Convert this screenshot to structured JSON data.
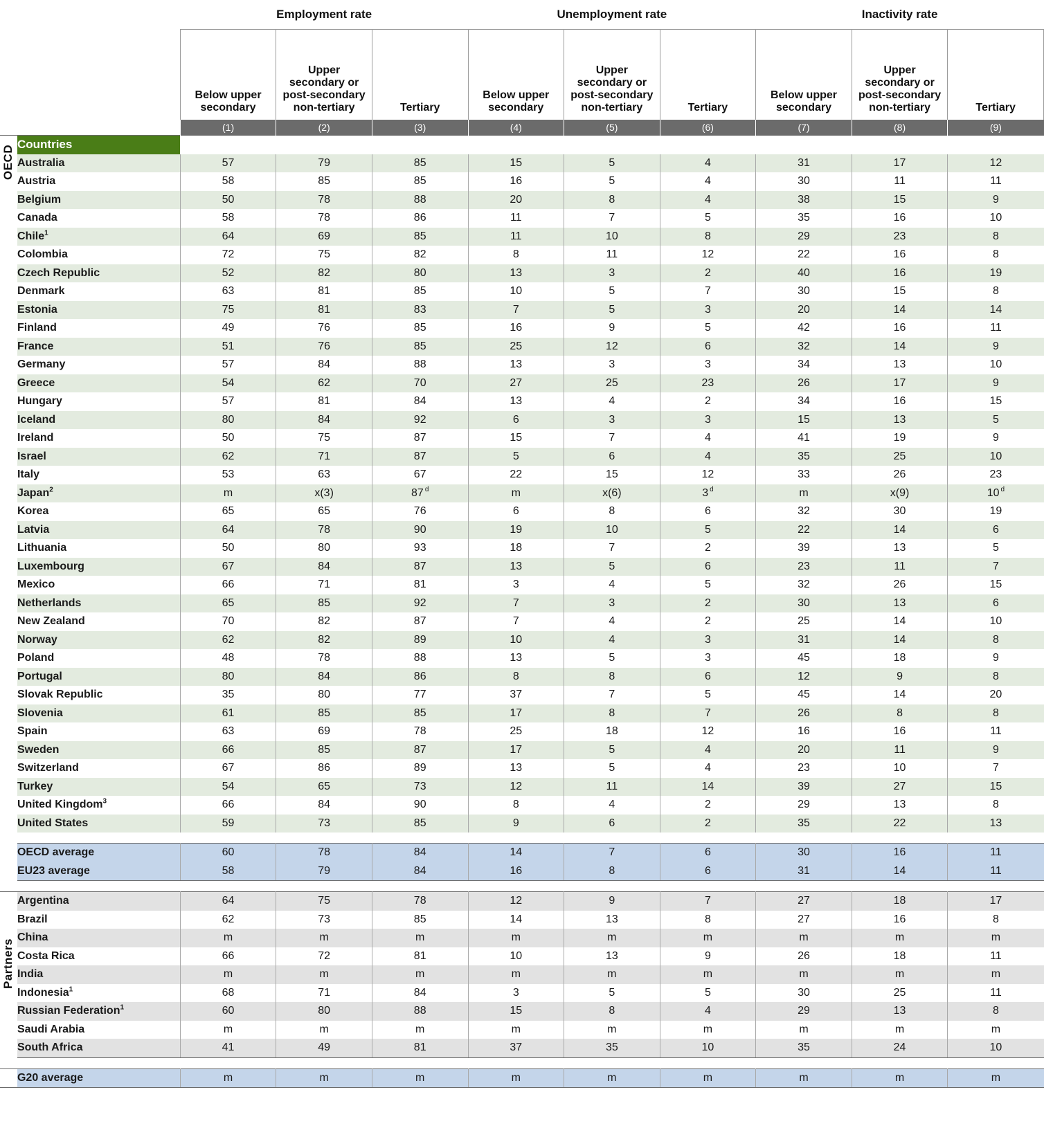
{
  "table": {
    "column_groups": [
      {
        "label": "Employment rate",
        "span": 3
      },
      {
        "label": "Unemployment rate",
        "span": 3
      },
      {
        "label": "Inactivity rate",
        "span": 3
      }
    ],
    "sub_headers": [
      "Below upper secondary",
      "Upper secondary or post-secondary non-tertiary",
      "Tertiary",
      "Below upper secondary",
      "Upper secondary or post-secondary non-tertiary",
      "Tertiary",
      "Below upper secondary",
      "Upper secondary or post-secondary non-tertiary",
      "Tertiary"
    ],
    "column_numbers": [
      "(1)",
      "(2)",
      "(3)",
      "(4)",
      "(5)",
      "(6)",
      "(7)",
      "(8)",
      "(9)"
    ],
    "section_labels": {
      "oecd": "OECD",
      "partners": "Partners",
      "countries_band": "Countries"
    },
    "colors": {
      "countries_band": "#4a7d17",
      "column_number_band": "#6b6b6b",
      "oecd_row_shade": "#e3ebdf",
      "partner_row_shade": "#e2e2e2",
      "average_row": "#c4d5ea",
      "grid_line": "#a8a8a8"
    },
    "oecd_rows": [
      {
        "name": "Australia",
        "values": [
          "57",
          "79",
          "85",
          "15",
          "5",
          "4",
          "31",
          "17",
          "12"
        ]
      },
      {
        "name": "Austria",
        "values": [
          "58",
          "85",
          "85",
          "16",
          "5",
          "4",
          "30",
          "11",
          "11"
        ]
      },
      {
        "name": "Belgium",
        "values": [
          "50",
          "78",
          "88",
          "20",
          "8",
          "4",
          "38",
          "15",
          "9"
        ]
      },
      {
        "name": "Canada",
        "values": [
          "58",
          "78",
          "86",
          "11",
          "7",
          "5",
          "35",
          "16",
          "10"
        ]
      },
      {
        "name": "Chile",
        "note": "1",
        "values": [
          "64",
          "69",
          "85",
          "11",
          "10",
          "8",
          "29",
          "23",
          "8"
        ]
      },
      {
        "name": "Colombia",
        "values": [
          "72",
          "75",
          "82",
          "8",
          "11",
          "12",
          "22",
          "16",
          "8"
        ]
      },
      {
        "name": "Czech Republic",
        "values": [
          "52",
          "82",
          "80",
          "13",
          "3",
          "2",
          "40",
          "16",
          "19"
        ]
      },
      {
        "name": "Denmark",
        "values": [
          "63",
          "81",
          "85",
          "10",
          "5",
          "7",
          "30",
          "15",
          "8"
        ]
      },
      {
        "name": "Estonia",
        "values": [
          "75",
          "81",
          "83",
          "7",
          "5",
          "3",
          "20",
          "14",
          "14"
        ]
      },
      {
        "name": "Finland",
        "values": [
          "49",
          "76",
          "85",
          "16",
          "9",
          "5",
          "42",
          "16",
          "11"
        ]
      },
      {
        "name": "France",
        "values": [
          "51",
          "76",
          "85",
          "25",
          "12",
          "6",
          "32",
          "14",
          "9"
        ]
      },
      {
        "name": "Germany",
        "values": [
          "57",
          "84",
          "88",
          "13",
          "3",
          "3",
          "34",
          "13",
          "10"
        ]
      },
      {
        "name": "Greece",
        "values": [
          "54",
          "62",
          "70",
          "27",
          "25",
          "23",
          "26",
          "17",
          "9"
        ]
      },
      {
        "name": "Hungary",
        "values": [
          "57",
          "81",
          "84",
          "13",
          "4",
          "2",
          "34",
          "16",
          "15"
        ]
      },
      {
        "name": "Iceland",
        "values": [
          "80",
          "84",
          "92",
          "6",
          "3",
          "3",
          "15",
          "13",
          "5"
        ]
      },
      {
        "name": "Ireland",
        "values": [
          "50",
          "75",
          "87",
          "15",
          "7",
          "4",
          "41",
          "19",
          "9"
        ]
      },
      {
        "name": "Israel",
        "values": [
          "62",
          "71",
          "87",
          "5",
          "6",
          "4",
          "35",
          "25",
          "10"
        ]
      },
      {
        "name": "Italy",
        "values": [
          "53",
          "63",
          "67",
          "22",
          "15",
          "12",
          "33",
          "26",
          "23"
        ]
      },
      {
        "name": "Japan",
        "note": "2",
        "values": [
          "m",
          "x(3)",
          "87",
          "m",
          "x(6)",
          "3",
          "m",
          "x(9)",
          "10"
        ],
        "flags": [
          "",
          "",
          "d",
          "",
          "",
          "d",
          "",
          "",
          "d"
        ]
      },
      {
        "name": "Korea",
        "values": [
          "65",
          "65",
          "76",
          "6",
          "8",
          "6",
          "32",
          "30",
          "19"
        ]
      },
      {
        "name": "Latvia",
        "values": [
          "64",
          "78",
          "90",
          "19",
          "10",
          "5",
          "22",
          "14",
          "6"
        ]
      },
      {
        "name": "Lithuania",
        "values": [
          "50",
          "80",
          "93",
          "18",
          "7",
          "2",
          "39",
          "13",
          "5"
        ]
      },
      {
        "name": "Luxembourg",
        "values": [
          "67",
          "84",
          "87",
          "13",
          "5",
          "6",
          "23",
          "11",
          "7"
        ]
      },
      {
        "name": "Mexico",
        "values": [
          "66",
          "71",
          "81",
          "3",
          "4",
          "5",
          "32",
          "26",
          "15"
        ]
      },
      {
        "name": "Netherlands",
        "values": [
          "65",
          "85",
          "92",
          "7",
          "3",
          "2",
          "30",
          "13",
          "6"
        ]
      },
      {
        "name": "New Zealand",
        "values": [
          "70",
          "82",
          "87",
          "7",
          "4",
          "2",
          "25",
          "14",
          "10"
        ]
      },
      {
        "name": "Norway",
        "values": [
          "62",
          "82",
          "89",
          "10",
          "4",
          "3",
          "31",
          "14",
          "8"
        ]
      },
      {
        "name": "Poland",
        "values": [
          "48",
          "78",
          "88",
          "13",
          "5",
          "3",
          "45",
          "18",
          "9"
        ]
      },
      {
        "name": "Portugal",
        "values": [
          "80",
          "84",
          "86",
          "8",
          "8",
          "6",
          "12",
          "9",
          "8"
        ]
      },
      {
        "name": "Slovak Republic",
        "values": [
          "35",
          "80",
          "77",
          "37",
          "7",
          "5",
          "45",
          "14",
          "20"
        ]
      },
      {
        "name": "Slovenia",
        "values": [
          "61",
          "85",
          "85",
          "17",
          "8",
          "7",
          "26",
          "8",
          "8"
        ]
      },
      {
        "name": "Spain",
        "values": [
          "63",
          "69",
          "78",
          "25",
          "18",
          "12",
          "16",
          "16",
          "11"
        ]
      },
      {
        "name": "Sweden",
        "values": [
          "66",
          "85",
          "87",
          "17",
          "5",
          "4",
          "20",
          "11",
          "9"
        ]
      },
      {
        "name": "Switzerland",
        "values": [
          "67",
          "86",
          "89",
          "13",
          "5",
          "4",
          "23",
          "10",
          "7"
        ]
      },
      {
        "name": "Turkey",
        "values": [
          "54",
          "65",
          "73",
          "12",
          "11",
          "14",
          "39",
          "27",
          "15"
        ]
      },
      {
        "name": "United Kingdom",
        "note": "3",
        "values": [
          "66",
          "84",
          "90",
          "8",
          "4",
          "2",
          "29",
          "13",
          "8"
        ]
      },
      {
        "name": "United States",
        "values": [
          "59",
          "73",
          "85",
          "9",
          "6",
          "2",
          "35",
          "22",
          "13"
        ]
      }
    ],
    "oecd_averages": [
      {
        "name": "OECD average",
        "values": [
          "60",
          "78",
          "84",
          "14",
          "7",
          "6",
          "30",
          "16",
          "11"
        ]
      },
      {
        "name": "EU23 average",
        "values": [
          "58",
          "79",
          "84",
          "16",
          "8",
          "6",
          "31",
          "14",
          "11"
        ]
      }
    ],
    "partner_rows": [
      {
        "name": "Argentina",
        "values": [
          "64",
          "75",
          "78",
          "12",
          "9",
          "7",
          "27",
          "18",
          "17"
        ]
      },
      {
        "name": "Brazil",
        "values": [
          "62",
          "73",
          "85",
          "14",
          "13",
          "8",
          "27",
          "16",
          "8"
        ]
      },
      {
        "name": "China",
        "values": [
          "m",
          "m",
          "m",
          "m",
          "m",
          "m",
          "m",
          "m",
          "m"
        ]
      },
      {
        "name": "Costa Rica",
        "values": [
          "66",
          "72",
          "81",
          "10",
          "13",
          "9",
          "26",
          "18",
          "11"
        ]
      },
      {
        "name": "India",
        "values": [
          "m",
          "m",
          "m",
          "m",
          "m",
          "m",
          "m",
          "m",
          "m"
        ]
      },
      {
        "name": "Indonesia",
        "note": "1",
        "values": [
          "68",
          "71",
          "84",
          "3",
          "5",
          "5",
          "30",
          "25",
          "11"
        ]
      },
      {
        "name": "Russian Federation",
        "note": "1",
        "values": [
          "60",
          "80",
          "88",
          "15",
          "8",
          "4",
          "29",
          "13",
          "8"
        ]
      },
      {
        "name": "Saudi Arabia",
        "values": [
          "m",
          "m",
          "m",
          "m",
          "m",
          "m",
          "m",
          "m",
          "m"
        ]
      },
      {
        "name": "South Africa",
        "values": [
          "41",
          "49",
          "81",
          "37",
          "35",
          "10",
          "35",
          "24",
          "10"
        ]
      }
    ],
    "g20_average": {
      "name": "G20 average",
      "values": [
        "m",
        "m",
        "m",
        "m",
        "m",
        "m",
        "m",
        "m",
        "m"
      ]
    }
  }
}
